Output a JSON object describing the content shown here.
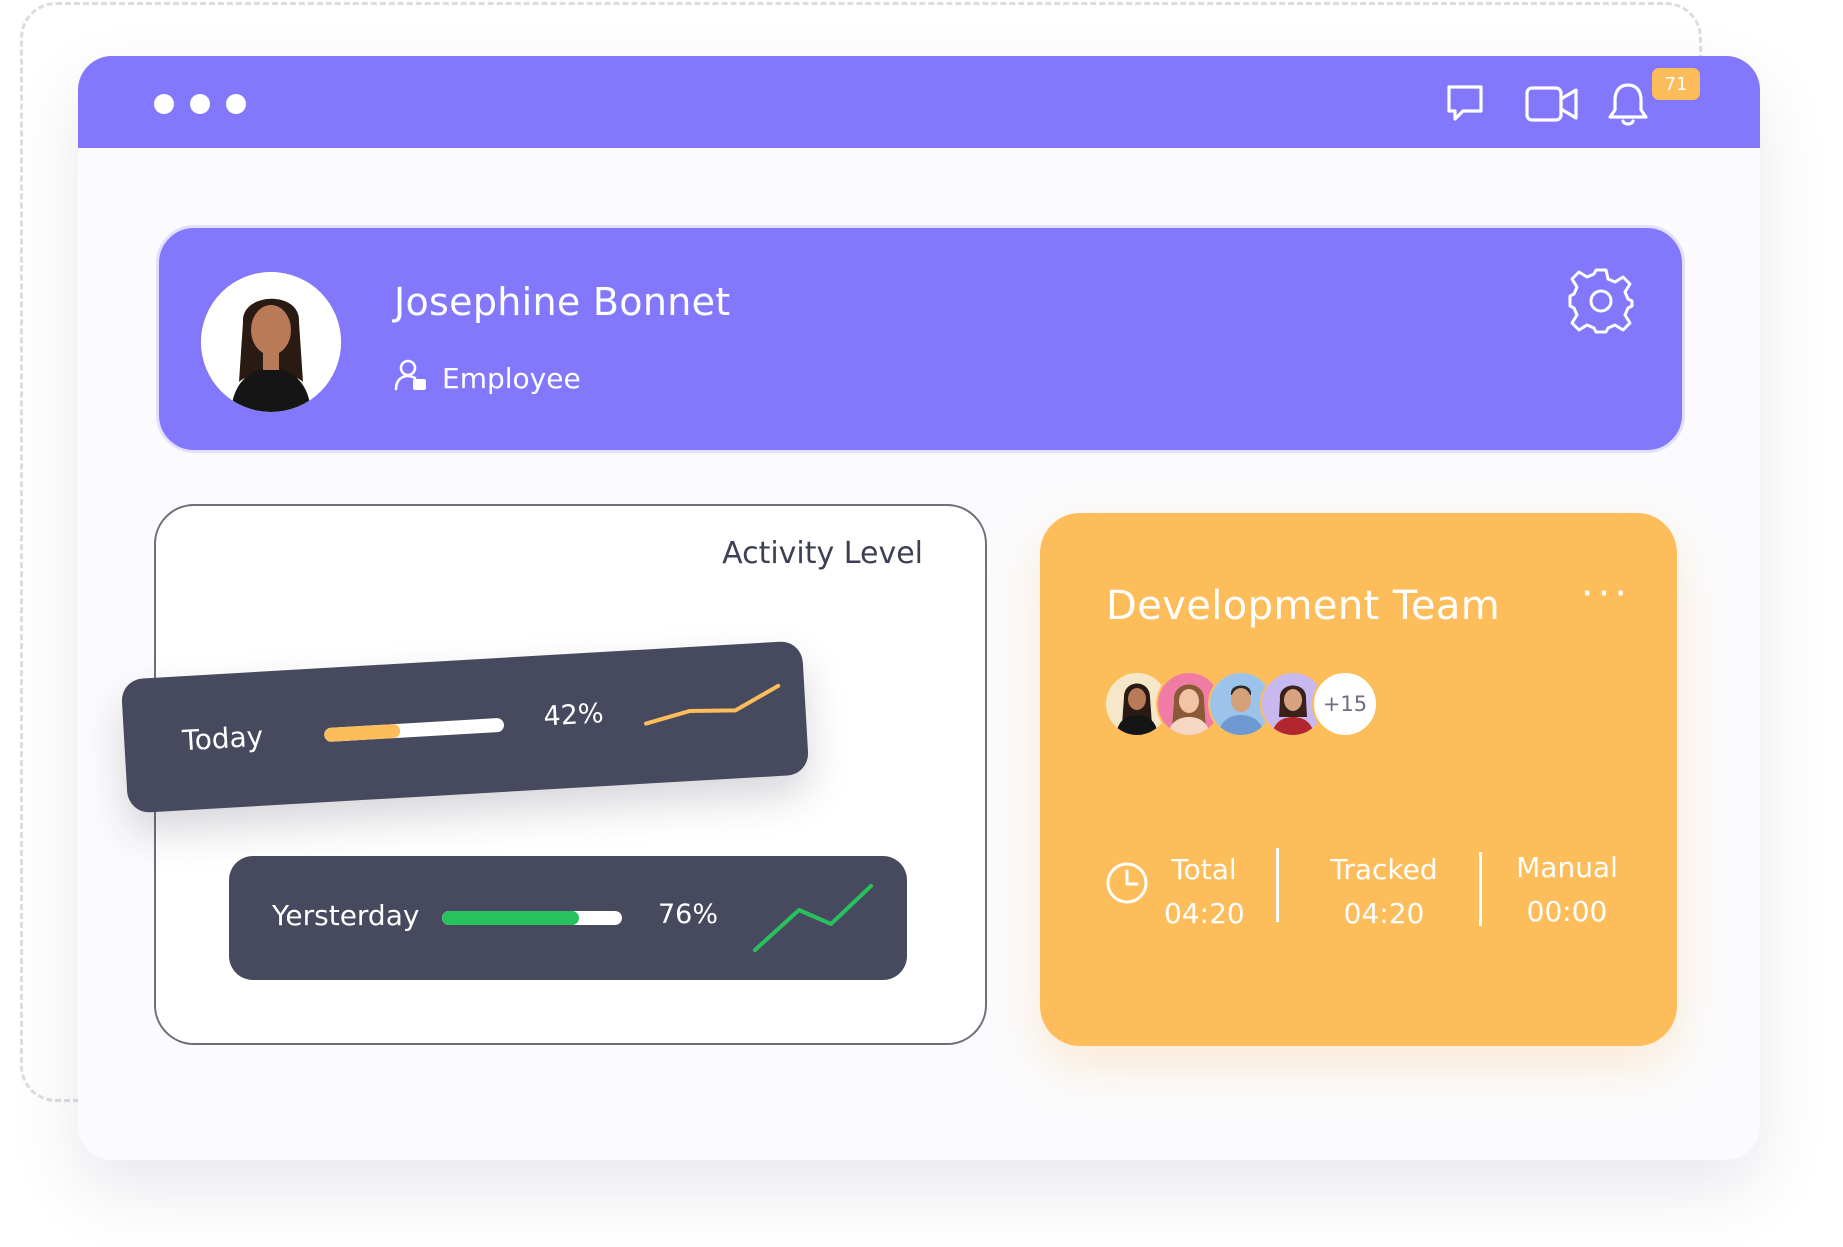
{
  "titlebar": {
    "icons": [
      "chat-icon",
      "video-camera-icon",
      "bell-icon"
    ],
    "notification_count": "71",
    "accent": "#8377fb"
  },
  "profile": {
    "name": "Josephine Bonnet",
    "role": "Employee"
  },
  "activity": {
    "title": "Activity Level",
    "rows": [
      {
        "label": "Today",
        "percent_text": "42%",
        "percent": 42,
        "bar_color": "#fdbd5a",
        "trend_color": "#fdbd5a"
      },
      {
        "label": "Yersterday",
        "percent_text": "76%",
        "percent": 76,
        "bar_color": "#27c25d",
        "trend_color": "#27c25d"
      }
    ]
  },
  "team": {
    "title": "Development Team",
    "more_label": "···",
    "extra_members": "+15",
    "stats": [
      {
        "label": "Total",
        "value": "04:20"
      },
      {
        "label": "Tracked",
        "value": "04:20"
      },
      {
        "label": "Manual",
        "value": "00:00"
      }
    ],
    "accent": "#fdbd5a"
  }
}
